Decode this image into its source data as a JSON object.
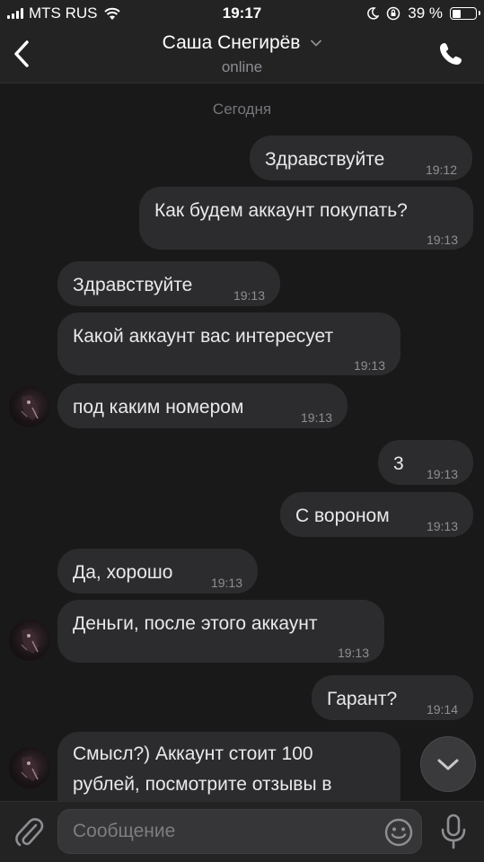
{
  "status_bar": {
    "carrier": "MTS RUS",
    "time": "19:17",
    "battery": "39 %",
    "battery_level": 0.39
  },
  "header": {
    "contact_name": "Саша Снегирёв",
    "status": "online"
  },
  "chat": {
    "date_label": "Сегодня",
    "messages": [
      {
        "direction": "outgoing",
        "text": "Здравствуйте",
        "time": "19:12"
      },
      {
        "direction": "outgoing",
        "text": "Как будем аккаунт покупать?",
        "time": "19:13"
      },
      {
        "direction": "incoming",
        "text": "Здравствуйте",
        "time": "19:13"
      },
      {
        "direction": "incoming",
        "text": "Какой аккаунт вас интересует",
        "time": "19:13"
      },
      {
        "direction": "incoming",
        "text": "под каким номером",
        "time": "19:13"
      },
      {
        "direction": "outgoing",
        "text": "3",
        "time": "19:13"
      },
      {
        "direction": "outgoing",
        "text": "С вороном",
        "time": "19:13"
      },
      {
        "direction": "incoming",
        "text": "Да, хорошо",
        "time": "19:13"
      },
      {
        "direction": "incoming",
        "text": "Деньги, после этого аккаунт",
        "time": "19:13"
      },
      {
        "direction": "outgoing",
        "text": "Гарант?",
        "time": "19:14"
      },
      {
        "direction": "incoming",
        "text_line1": "Смысл?) Аккаунт стоит 100",
        "text_line2": "рублей, посмотрите отзывы в"
      }
    ]
  },
  "input": {
    "placeholder": "Сообщение"
  },
  "colors": {
    "background": "#19191a",
    "bubble": "#2c2c2e",
    "bar": "#232324"
  }
}
